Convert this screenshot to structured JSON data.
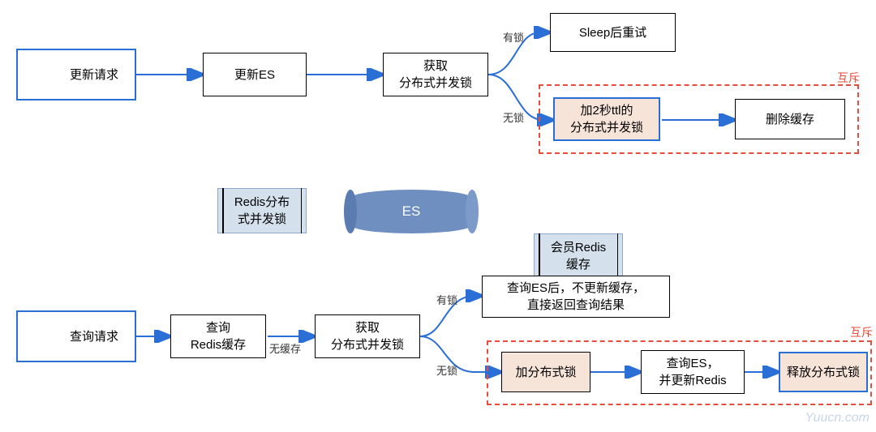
{
  "colors": {
    "blue": "#2a6fd6",
    "red": "#e74c3c",
    "cylFill": "#6f8fc1",
    "lightBlue": "#d4e0ec",
    "lightOrange": "#f7e4d9"
  },
  "flows": {
    "update": {
      "start": "更新请求",
      "step1": "更新ES",
      "step2": "获取\n分布式并发锁",
      "branch_locked_label": "有锁",
      "branch_unlocked_label": "无锁",
      "locked_action": "Sleep后重试",
      "unlocked_step1": "加2秒ttl的\n分布式并发锁",
      "unlocked_step2": "删除缓存",
      "mutex_label": "互斥"
    },
    "query": {
      "start": "查询请求",
      "step1": "查询\nRedis缓存",
      "no_cache_label": "无缓存",
      "step2": "获取\n分布式并发锁",
      "branch_locked_label": "有锁",
      "branch_unlocked_label": "无锁",
      "locked_action": "查询ES后，不更新缓存，\n直接返回查询结果",
      "unlocked_step1": "加分布式锁",
      "unlocked_step2": "查询ES，\n并更新Redis",
      "unlocked_step3": "释放分布式锁",
      "mutex_label": "互斥"
    }
  },
  "stores": {
    "redis_lock": "Redis分布\n式并发锁",
    "es": "ES",
    "member_redis": "会员Redis\n缓存"
  },
  "watermark": "Yuucn.com"
}
